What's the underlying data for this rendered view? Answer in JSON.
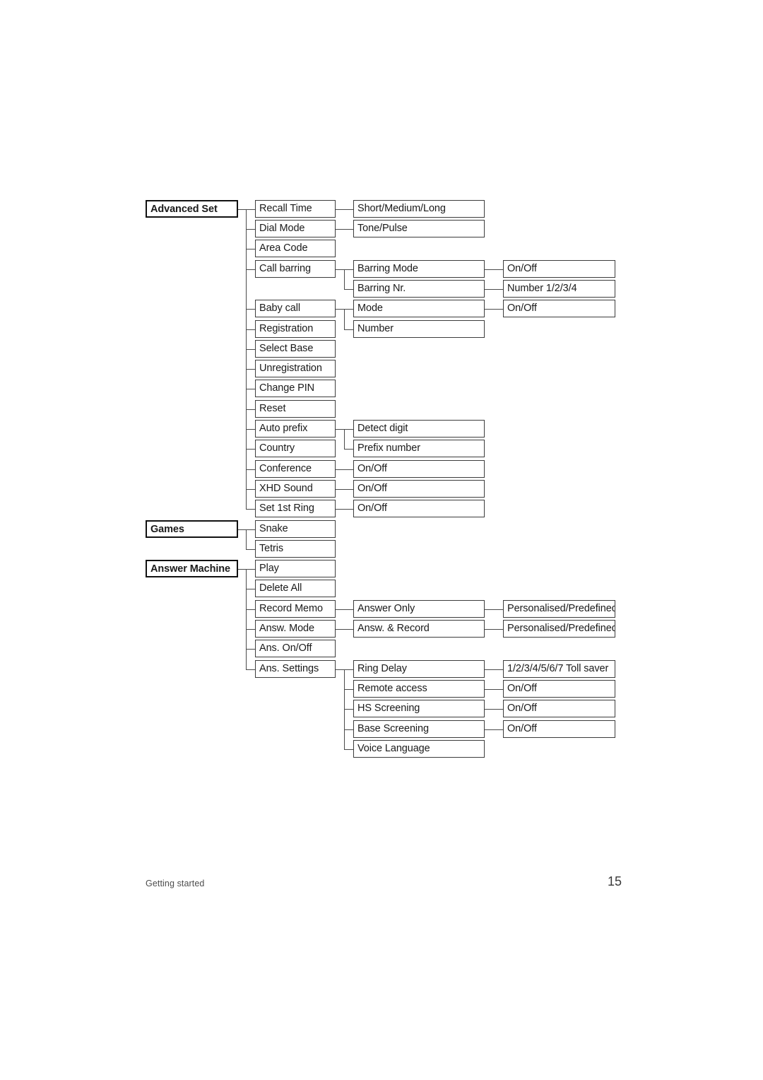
{
  "document": {
    "footer_chapter": "Getting started",
    "page_number": "15"
  },
  "colors": {
    "box_border": "#3c3c3c",
    "header_border": "#111111",
    "connector": "#4a4a4a",
    "text": "#1a1a1a",
    "page_background": "#ffffff"
  },
  "diagram": {
    "type": "menu-tree",
    "columns": 4,
    "sections": [
      {
        "id": "advanced-set",
        "title": "Advanced Set",
        "items": [
          {
            "label": "Recall Time",
            "children": [
              {
                "label": "Short/Medium/Long"
              }
            ]
          },
          {
            "label": "Dial Mode",
            "children": [
              {
                "label": "Tone/Pulse"
              }
            ]
          },
          {
            "label": "Area Code",
            "children": []
          },
          {
            "label": "Call barring",
            "children": [
              {
                "label": "Barring Mode",
                "children": [
                  {
                    "label": "On/Off"
                  }
                ]
              },
              {
                "label": "Barring Nr.",
                "children": [
                  {
                    "label": "Number 1/2/3/4"
                  }
                ]
              }
            ]
          },
          {
            "label": "Baby call",
            "children": [
              {
                "label": "Mode",
                "children": [
                  {
                    "label": "On/Off"
                  }
                ]
              },
              {
                "label": "Number",
                "children": []
              }
            ]
          },
          {
            "label": "Registration",
            "children": []
          },
          {
            "label": "Select Base",
            "children": []
          },
          {
            "label": "Unregistration",
            "children": []
          },
          {
            "label": "Change PIN",
            "children": []
          },
          {
            "label": "Reset",
            "children": []
          },
          {
            "label": "Auto prefix",
            "children": [
              {
                "label": "Detect digit"
              },
              {
                "label": "Prefix number"
              }
            ]
          },
          {
            "label": "Country",
            "children": []
          },
          {
            "label": "Conference",
            "children": [
              {
                "label": "On/Off"
              }
            ]
          },
          {
            "label": "XHD Sound",
            "children": [
              {
                "label": "On/Off"
              }
            ]
          },
          {
            "label": "Set 1st Ring",
            "children": [
              {
                "label": "On/Off"
              }
            ]
          }
        ]
      },
      {
        "id": "games",
        "title": "Games",
        "items": [
          {
            "label": "Snake",
            "children": []
          },
          {
            "label": "Tetris",
            "children": []
          }
        ]
      },
      {
        "id": "answer-machine",
        "title": "Answer Machine",
        "items": [
          {
            "label": "Play",
            "children": []
          },
          {
            "label": "Delete All",
            "children": []
          },
          {
            "label": "Record Memo",
            "children": [
              {
                "label": "Answer Only",
                "children": [
                  {
                    "label": "Personalised/Predefined"
                  }
                ]
              }
            ]
          },
          {
            "label": "Answ. Mode",
            "children": [
              {
                "label": "Answ. & Record",
                "children": [
                  {
                    "label": "Personalised/Predefined"
                  }
                ]
              }
            ]
          },
          {
            "label": "Ans. On/Off",
            "children": []
          },
          {
            "label": "Ans. Settings",
            "children": [
              {
                "label": "Ring Delay",
                "children": [
                  {
                    "label": "1/2/3/4/5/6/7 Toll saver"
                  }
                ]
              },
              {
                "label": "Remote access",
                "children": [
                  {
                    "label": "On/Off"
                  }
                ]
              },
              {
                "label": "HS Screening",
                "children": [
                  {
                    "label": "On/Off"
                  }
                ]
              },
              {
                "label": "Base Screening",
                "children": [
                  {
                    "label": "On/Off"
                  }
                ]
              },
              {
                "label": "Voice Language",
                "children": []
              }
            ]
          }
        ]
      }
    ],
    "nodes": [
      {
        "key": "n01",
        "label": "Advanced Set",
        "col": 1,
        "row": 0,
        "header": true
      },
      {
        "key": "n02",
        "label": "Recall Time",
        "col": 2,
        "row": 0
      },
      {
        "key": "n03",
        "label": "Short/Medium/Long",
        "col": 3,
        "row": 0
      },
      {
        "key": "n04",
        "label": "Dial Mode",
        "col": 2,
        "row": 1
      },
      {
        "key": "n05",
        "label": "Tone/Pulse",
        "col": 3,
        "row": 1
      },
      {
        "key": "n06",
        "label": "Area Code",
        "col": 2,
        "row": 2
      },
      {
        "key": "n07",
        "label": "Call barring",
        "col": 2,
        "row": 3
      },
      {
        "key": "n08",
        "label": "Barring Mode",
        "col": 3,
        "row": 3
      },
      {
        "key": "n09",
        "label": "On/Off",
        "col": 4,
        "row": 3
      },
      {
        "key": "n10",
        "label": "Barring Nr.",
        "col": 3,
        "row": 4
      },
      {
        "key": "n11",
        "label": "Number 1/2/3/4",
        "col": 4,
        "row": 4
      },
      {
        "key": "n12",
        "label": "Baby call",
        "col": 2,
        "row": 5
      },
      {
        "key": "n13",
        "label": "Mode",
        "col": 3,
        "row": 5
      },
      {
        "key": "n14",
        "label": "On/Off",
        "col": 4,
        "row": 5
      },
      {
        "key": "n15",
        "label": "Registration",
        "col": 2,
        "row": 6
      },
      {
        "key": "n16",
        "label": "Number",
        "col": 3,
        "row": 6
      },
      {
        "key": "n17",
        "label": "Select Base",
        "col": 2,
        "row": 7
      },
      {
        "key": "n18",
        "label": "Unregistration",
        "col": 2,
        "row": 8
      },
      {
        "key": "n19",
        "label": "Change PIN",
        "col": 2,
        "row": 9
      },
      {
        "key": "n20",
        "label": "Reset",
        "col": 2,
        "row": 10
      },
      {
        "key": "n21",
        "label": "Auto prefix",
        "col": 2,
        "row": 11
      },
      {
        "key": "n22",
        "label": "Detect digit",
        "col": 3,
        "row": 11
      },
      {
        "key": "n23",
        "label": "Country",
        "col": 2,
        "row": 12
      },
      {
        "key": "n24",
        "label": "Prefix number",
        "col": 3,
        "row": 12
      },
      {
        "key": "n25",
        "label": "Conference",
        "col": 2,
        "row": 13
      },
      {
        "key": "n26",
        "label": "On/Off",
        "col": 3,
        "row": 13
      },
      {
        "key": "n27",
        "label": "XHD Sound",
        "col": 2,
        "row": 14
      },
      {
        "key": "n28",
        "label": "On/Off",
        "col": 3,
        "row": 14
      },
      {
        "key": "n29",
        "label": "Set 1st Ring",
        "col": 2,
        "row": 15
      },
      {
        "key": "n30",
        "label": "On/Off",
        "col": 3,
        "row": 15
      },
      {
        "key": "n31",
        "label": "Games",
        "col": 1,
        "row": 16,
        "header": true
      },
      {
        "key": "n32",
        "label": "Snake",
        "col": 2,
        "row": 16
      },
      {
        "key": "n33",
        "label": "Tetris",
        "col": 2,
        "row": 17
      },
      {
        "key": "n34",
        "label": "Answer Machine",
        "col": 1,
        "row": 18,
        "header": true
      },
      {
        "key": "n35",
        "label": "Play",
        "col": 2,
        "row": 18
      },
      {
        "key": "n36",
        "label": "Delete All",
        "col": 2,
        "row": 19
      },
      {
        "key": "n37",
        "label": "Record Memo",
        "col": 2,
        "row": 20
      },
      {
        "key": "n38",
        "label": "Answer Only",
        "col": 3,
        "row": 20
      },
      {
        "key": "n39",
        "label": "Personalised/Predefined",
        "col": 4,
        "row": 20
      },
      {
        "key": "n40",
        "label": "Answ. Mode",
        "col": 2,
        "row": 21
      },
      {
        "key": "n41",
        "label": "Answ. & Record",
        "col": 3,
        "row": 21
      },
      {
        "key": "n42",
        "label": "Personalised/Predefined",
        "col": 4,
        "row": 21
      },
      {
        "key": "n43",
        "label": "Ans. On/Off",
        "col": 2,
        "row": 22
      },
      {
        "key": "n44",
        "label": "Ans. Settings",
        "col": 2,
        "row": 23
      },
      {
        "key": "n45",
        "label": "Ring Delay",
        "col": 3,
        "row": 23
      },
      {
        "key": "n46",
        "label": "1/2/3/4/5/6/7 Toll saver",
        "col": 4,
        "row": 23
      },
      {
        "key": "n47",
        "label": "Remote access",
        "col": 3,
        "row": 24
      },
      {
        "key": "n48",
        "label": "On/Off",
        "col": 4,
        "row": 24
      },
      {
        "key": "n49",
        "label": "HS Screening",
        "col": 3,
        "row": 25
      },
      {
        "key": "n50",
        "label": "On/Off",
        "col": 4,
        "row": 25
      },
      {
        "key": "n51",
        "label": "Base Screening",
        "col": 3,
        "row": 26
      },
      {
        "key": "n52",
        "label": "On/Off",
        "col": 4,
        "row": 26
      },
      {
        "key": "n53",
        "label": "Voice Language",
        "col": 3,
        "row": 27
      }
    ]
  }
}
